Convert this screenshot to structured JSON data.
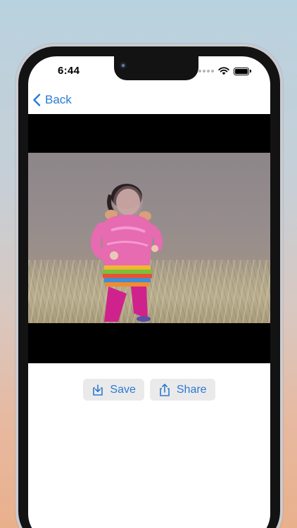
{
  "status_bar": {
    "time": "6:44"
  },
  "nav": {
    "back_label": "Back",
    "back_icon": "chevron-left-icon"
  },
  "actions": {
    "save_label": "Save",
    "save_icon": "save-to-device-icon",
    "share_label": "Share",
    "share_icon": "share-icon"
  },
  "colors": {
    "accent": "#2a7ad4",
    "button_bg": "#eaeaea",
    "letterbox": "#000000"
  }
}
